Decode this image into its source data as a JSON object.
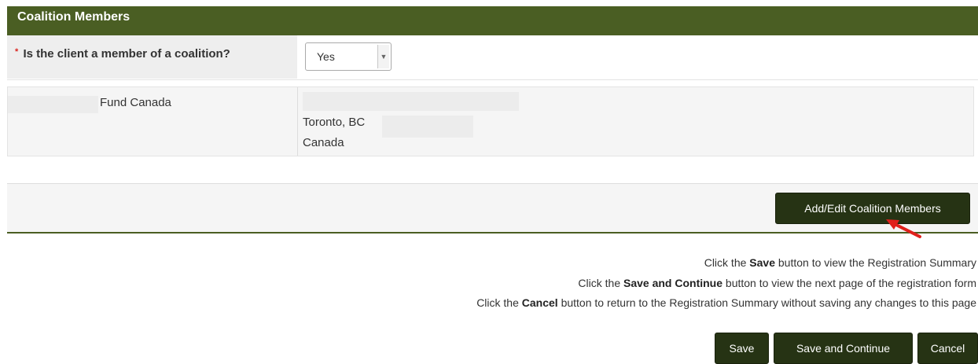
{
  "section": {
    "title": "Coalition Members"
  },
  "question": {
    "required_marker": "*",
    "label": "Is the client a member of a coalition?",
    "select_value": "Yes"
  },
  "member": {
    "name": "Fund Canada",
    "city_line": "Toronto, BC",
    "country": "Canada"
  },
  "actions": {
    "add_edit_label": "Add/Edit Coalition Members"
  },
  "instructions": [
    {
      "prefix": "Click the ",
      "bold": "Save",
      "suffix": " button to view the Registration Summary"
    },
    {
      "prefix": "Click the ",
      "bold": "Save and Continue",
      "suffix": " button to view the next page of the registration form"
    },
    {
      "prefix": "Click the ",
      "bold": "Cancel",
      "suffix": " button to return to the Registration Summary without saving any changes to this page"
    }
  ],
  "footer": {
    "save_label": "Save",
    "save_continue_label": "Save and Continue",
    "cancel_label": "Cancel"
  },
  "colors": {
    "header_bg": "#4a5e23",
    "button_bg": "#263314",
    "required_marker": "#d9241e",
    "annotation_arrow": "#e0201b"
  },
  "icons": {
    "select_arrow": "chevron-down-icon",
    "annotation": "red-arrow-icon"
  }
}
